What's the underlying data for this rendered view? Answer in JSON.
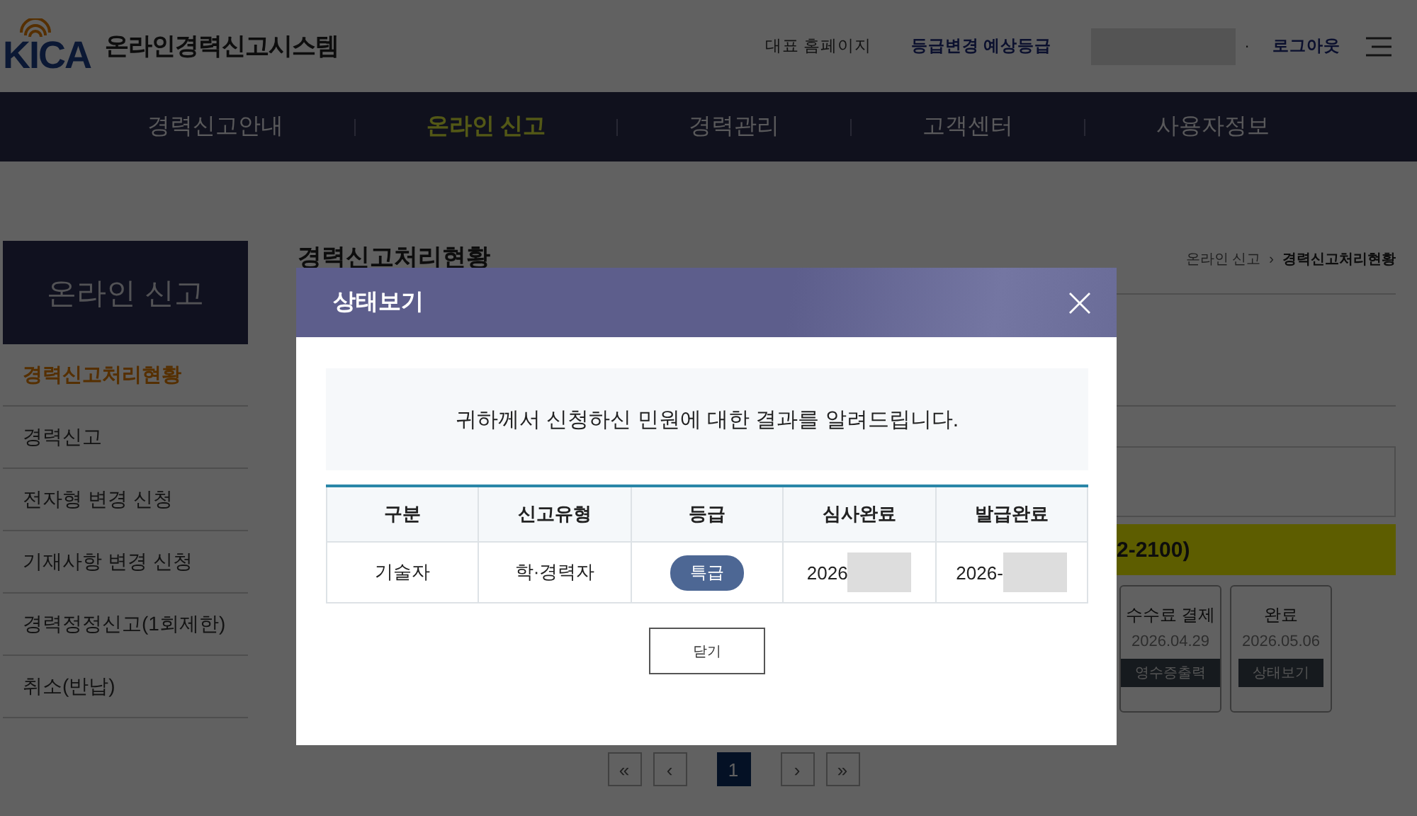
{
  "header": {
    "logo": "KICA",
    "site_title": "온라인경력신고시스템",
    "links": [
      "대표 홈페이지",
      "등급변경 예상등급"
    ],
    "separator": "·",
    "logout": "로그아웃"
  },
  "nav": {
    "items": [
      {
        "label": "경력신고안내",
        "selected": false
      },
      {
        "label": "온라인 신고",
        "selected": true
      },
      {
        "label": "경력관리",
        "selected": false
      },
      {
        "label": "고객센터",
        "selected": false
      },
      {
        "label": "사용자정보",
        "selected": false
      }
    ]
  },
  "sidebar": {
    "title": "온라인 신고",
    "items": [
      {
        "label": "경력신고처리현황",
        "selected": true
      },
      {
        "label": "경력신고",
        "selected": false
      },
      {
        "label": "전자형 변경 신청",
        "selected": false
      },
      {
        "label": "기재사항 변경 신청",
        "selected": false
      },
      {
        "label": "경력정정신고(1회제한)",
        "selected": false
      },
      {
        "label": "취소(반납)",
        "selected": false
      }
    ]
  },
  "content": {
    "title": "경력신고처리현황",
    "breadcrumb": [
      "온라인 신고",
      "경력신고처리현황"
    ],
    "breadcrumb_separator": "›",
    "notice": "2-2100)",
    "steps": [
      {
        "title": "수수료 결제",
        "date": "2026.04.29",
        "action": "영수증출력"
      },
      {
        "title": "완료",
        "date": "2026.05.06",
        "action": "상태보기"
      }
    ]
  },
  "pagination": {
    "first": "«",
    "prev": "‹",
    "pages": [
      {
        "label": "1",
        "selected": true
      }
    ],
    "next": "›",
    "last": "»"
  },
  "modal": {
    "title": "상태보기",
    "message": "귀하께서 신청하신 민원에 대한 결과를 알려드립니다.",
    "table": {
      "columns": [
        "구분",
        "신고유형",
        "등급",
        "심사완료",
        "발급완료"
      ],
      "rows": [
        {
          "cells": [
            {
              "kind": "text",
              "text": "기술자"
            },
            {
              "kind": "text",
              "text": "학·경력자"
            },
            {
              "kind": "badge",
              "text": "특급"
            },
            {
              "kind": "date",
              "text": "2026"
            },
            {
              "kind": "date",
              "text": "2026-"
            }
          ]
        }
      ]
    },
    "close_button": "닫기"
  }
}
